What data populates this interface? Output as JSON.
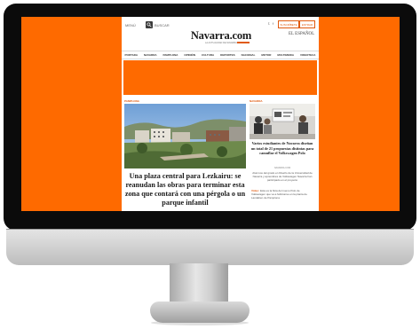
{
  "site": {
    "logo": "Navarra.com",
    "tagline": "LA ACTUALIDAD DE NAVARRA",
    "partner_logo": "EL ESPAÑOL"
  },
  "topbar": {
    "menu_label": "MENÚ",
    "search_label": "BUSCAR",
    "social_icons": [
      "twitter-icon",
      "facebook-icon"
    ],
    "subscribe_label": "SUSCRÍBETE",
    "login_label": "ENTRAR"
  },
  "nav": {
    "items": [
      "PORTADA",
      "NAVARRA",
      "PAMPLONA",
      "OPINIÓN",
      "CULTURA",
      "DEPORTES",
      "NACIONAL",
      "MOTOR",
      "MULTIMEDIA",
      "VIDEOTECA"
    ]
  },
  "colors": {
    "screen_background": "#fe6a00",
    "accent": "#e05a0f",
    "bezel": "#0b0b0b"
  },
  "lead": {
    "section": "PAMPLONA",
    "headline": "Una plaza central para Lezkairu: se reanudan las obras para terminar esta zona que contará con una pérgola o un parque infantil"
  },
  "side": {
    "section": "NAVARRA",
    "headline": "Varios estudiantes de Navarra diseñan un total de 21 propuestas distintas para camuflar el Volkswagen Polo",
    "meta": "NAVARRA.COM",
    "description": "Alumnos del grado en Diseño de la Universidad de Navarra y aprendices de Volkswagen Navarra han participado en el proyecto",
    "related_tag": "Video:",
    "related_text": "Esta es la flota del nuevo Polo de Volkswagen que va a fabricarse en la planta de Landaben de Pamplona"
  }
}
